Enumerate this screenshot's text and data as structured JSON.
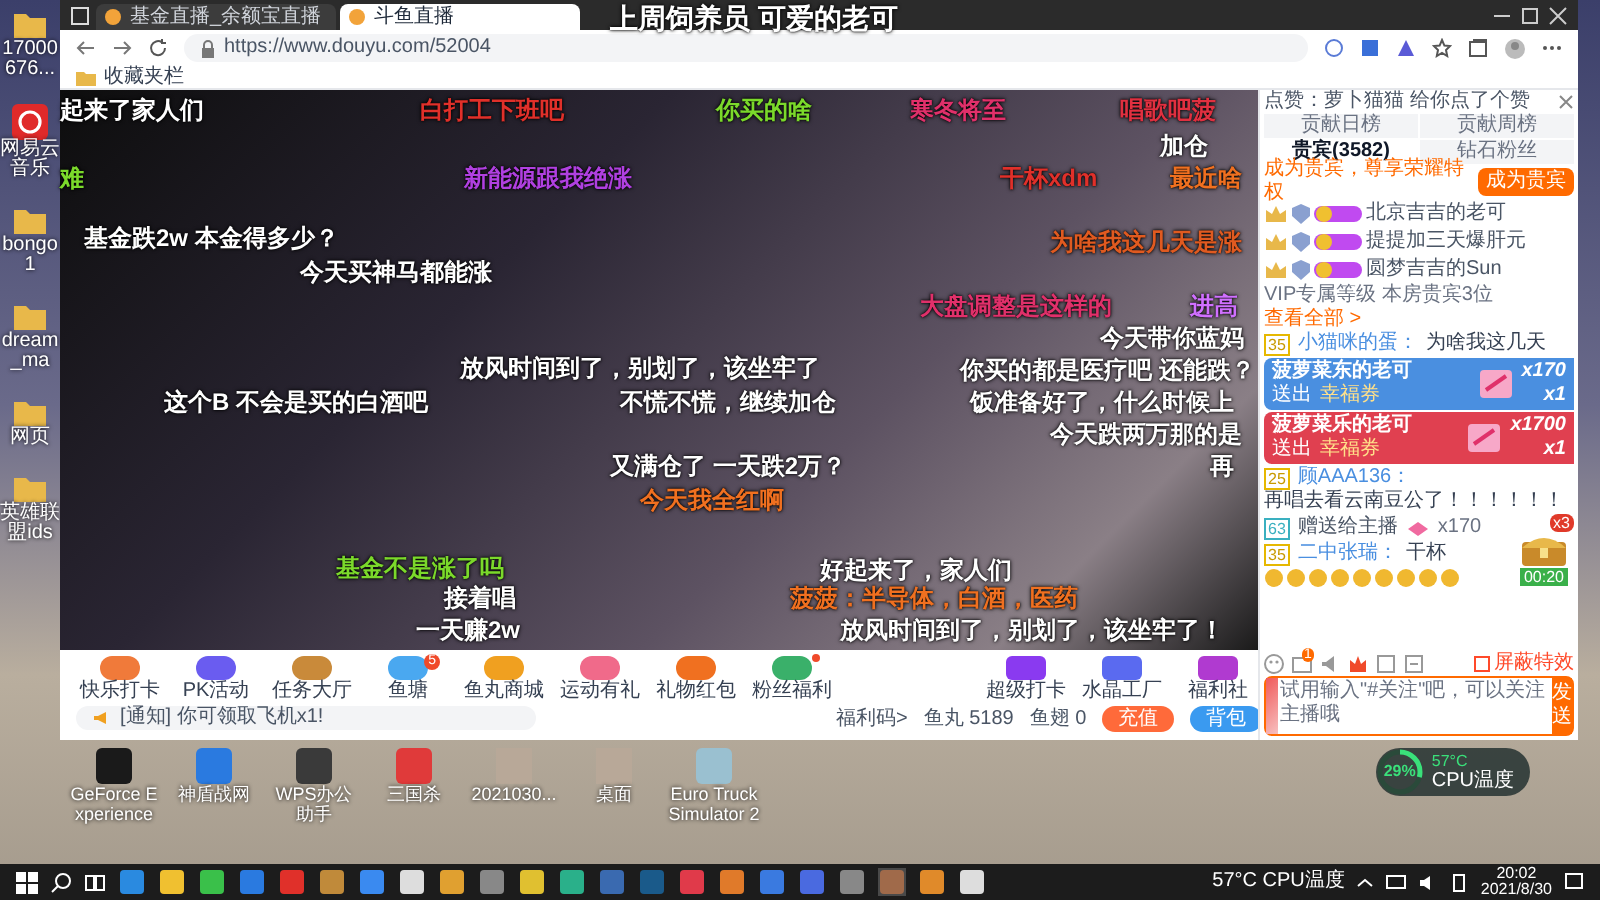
{
  "browser": {
    "tabs": [
      {
        "title": "基金直播_余额宝直播",
        "selected": false
      },
      {
        "title": "斗鱼直播",
        "selected": true
      }
    ],
    "url": "https://www.douyu.com/52004",
    "bookmark": "收藏夹栏"
  },
  "danmaku": [
    {
      "text": "上周饲养员 可爱的老可",
      "color": "#ffffff"
    },
    {
      "text": "起来了家人们",
      "color": "#ffffff"
    },
    {
      "text": "白打工下班吧",
      "color": "#e0302a"
    },
    {
      "text": "你买的啥",
      "color": "#7bd92b"
    },
    {
      "text": "寒冬将至",
      "color": "#e0306a"
    },
    {
      "text": "唱歌吧菠",
      "color": "#e03040"
    },
    {
      "text": "加仓",
      "color": "#ffffff"
    },
    {
      "text": "难",
      "color": "#7bd92b"
    },
    {
      "text": "新能源跟我绝涨",
      "color": "#b040e0"
    },
    {
      "text": "干杯xdm",
      "color": "#e0302a"
    },
    {
      "text": "最近啥",
      "color": "#f07020"
    },
    {
      "text": "基金跌2w 本金得多少？",
      "color": "#ffffff"
    },
    {
      "text": "为啥我这几天是涨",
      "color": "#e05a20"
    },
    {
      "text": "今天买神马都能涨",
      "color": "#ffffff"
    },
    {
      "text": "大盘调整是这样的",
      "color": "#e0306a"
    },
    {
      "text": "进高",
      "color": "#d070ff"
    },
    {
      "text": "今天带你蓝妈",
      "color": "#ffffff"
    },
    {
      "text": "放风时间到了，别划了，该坐牢了",
      "color": "#ffffff"
    },
    {
      "text": "你买的都是医疗吧 还能跌？",
      "color": "#ffffff"
    },
    {
      "text": "这个B 不会是买的白酒吧",
      "color": "#ffffff"
    },
    {
      "text": "不慌不慌，继续加仓",
      "color": "#ffffff"
    },
    {
      "text": "饭准备好了，什么时候上",
      "color": "#ffffff"
    },
    {
      "text": "今天跌两万那的是",
      "color": "#ffffff"
    },
    {
      "text": "又满仓了 一天跌2万？",
      "color": "#ffffff"
    },
    {
      "text": "再",
      "color": "#ffffff"
    },
    {
      "text": "今天我全红啊",
      "color": "#f07020"
    },
    {
      "text": "基金不是涨了吗",
      "color": "#7bd92b"
    },
    {
      "text": "好起来了，家人们",
      "color": "#ffffff"
    },
    {
      "text": "接着唱",
      "color": "#ffffff"
    },
    {
      "text": "菠菠：半导体，白酒，医药",
      "color": "#f07020"
    },
    {
      "text": "一天赚2w",
      "color": "#ffffff"
    },
    {
      "text": "放风时间到了，别划了，该坐牢了！",
      "color": "#ffffff"
    }
  ],
  "chat_panel": {
    "like_notice": "点赞：萝卜猫猫 给你点了个赞",
    "tabs": [
      {
        "label": "贡献日榜",
        "selected": false
      },
      {
        "label": "贡献周榜",
        "selected": false
      },
      {
        "label": "贵宾(3582)",
        "selected": true
      },
      {
        "label": "钻石粉丝",
        "selected": false
      }
    ],
    "vip_promo": "成为贵宾，尊享荣耀特权",
    "vip_button": "成为贵宾",
    "vip_rows": [
      {
        "name": "北京吉吉的老可"
      },
      {
        "name": "提提加三天爆肝元"
      },
      {
        "name": "圆梦吉吉的Sun"
      }
    ],
    "vip_footer": "VIP专属等级 本房贵宾3位",
    "vip_link": "查看全部 >",
    "messages": [
      {
        "kind": "chat",
        "level": "35",
        "user": "小猫咪的蛋：",
        "text": "为啥我这几天"
      },
      {
        "kind": "banner",
        "user": "菠萝菜东的老可",
        "action": "送出",
        "gift": "幸福券",
        "count": "x170",
        "multiplier": "x1",
        "color": "#4a8fe0"
      },
      {
        "kind": "banner",
        "user": "菠萝菜乐的老可",
        "action": "送出",
        "gift": "幸福券",
        "count": "x1700",
        "multiplier": "x1",
        "color": "#e04050"
      },
      {
        "kind": "chat",
        "level": "25",
        "user": "顾AAA136：",
        "text": "再唱去看云南豆公了！！！！！！"
      }
    ],
    "side_messages": [
      {
        "kind": "gift",
        "level": "63",
        "text": "赠送给主播",
        "count": "x170"
      },
      {
        "kind": "chat",
        "level": "35",
        "user": "二中张瑞：",
        "text": "干杯"
      },
      {
        "kind": "emotes"
      }
    ],
    "chest": {
      "count": "x3",
      "timer": "00:20"
    },
    "message_badge": "1",
    "shield": "屏蔽特效",
    "input": {
      "placeholder": "试用输入\"#关注\"吧，可以关注主播哦"
    },
    "send": "发送"
  },
  "gift_bar": {
    "activities": [
      {
        "label": "快乐打卡",
        "new": false
      },
      {
        "label": "PK活动",
        "new": false
      },
      {
        "label": "任务大厅",
        "new": false
      },
      {
        "label": "鱼塘",
        "new": false,
        "badge": "5"
      },
      {
        "label": "鱼丸商城",
        "new": false
      },
      {
        "label": "运动有礼",
        "new": false
      },
      {
        "label": "礼物红包",
        "new": false
      },
      {
        "label": "粉丝福利",
        "new": true
      }
    ],
    "notice": "[通知] 你可领取飞机x1!",
    "promos": [
      "超级打卡",
      "水晶工厂",
      "福利社"
    ],
    "welfare": "福利码>",
    "yuwan": "鱼丸 5189",
    "yuchi": "鱼翅 0",
    "buttons": [
      {
        "label": "充值",
        "kind": "recharge"
      },
      {
        "label": "背包",
        "kind": "backpack"
      }
    ]
  },
  "desktop": {
    "left_icons": [
      {
        "label": "17000676...",
        "kind": "folder"
      },
      {
        "label": "网易云音乐",
        "kind": "music"
      },
      {
        "label": "bongo1",
        "kind": "folder"
      },
      {
        "label": "dream_ma",
        "kind": "folder"
      },
      {
        "label": "网页",
        "kind": "folder"
      },
      {
        "label": "英雄联盟ids",
        "kind": "folder"
      }
    ],
    "bottom_icons": [
      {
        "label": "GeForce Experience",
        "kind": "app"
      },
      {
        "label": "神盾战网",
        "kind": "app"
      },
      {
        "label": "WPS办公助手",
        "kind": "app"
      },
      {
        "label": "三国杀",
        "kind": "app"
      },
      {
        "label": "2021030...",
        "kind": "photo"
      },
      {
        "label": "桌面",
        "kind": "photo"
      },
      {
        "label": "Euro Truck Simulator 2",
        "kind": "app"
      }
    ],
    "cpu_widget": {
      "usage": "29%",
      "temp": "57°C",
      "label": "CPU温度",
      "level": 0.29
    }
  },
  "taskbar": {
    "cpu": "57°C CPU温度",
    "time": "20:02",
    "date": "2021/8/30"
  }
}
